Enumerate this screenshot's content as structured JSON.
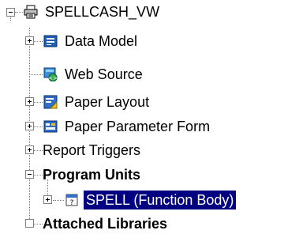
{
  "tree": {
    "root": {
      "label": "SPELLCASH_VW",
      "icon": "report-module-icon"
    },
    "items": [
      {
        "label": "Data Model",
        "icon": "data-model-icon"
      },
      {
        "label": "Web Source",
        "icon": "web-source-icon"
      },
      {
        "label": "Paper Layout",
        "icon": "paper-layout-icon"
      },
      {
        "label": "Paper Parameter Form",
        "icon": "parameter-form-icon"
      },
      {
        "label": "Report Triggers"
      },
      {
        "label": "Program Units"
      },
      {
        "label": "SPELL (Function Body)",
        "icon": "program-unit-icon"
      },
      {
        "label": "Attached Libraries"
      }
    ]
  },
  "colors": {
    "selection_bg": "#000080",
    "selection_fg": "#ffffff",
    "connector": "#808080"
  }
}
